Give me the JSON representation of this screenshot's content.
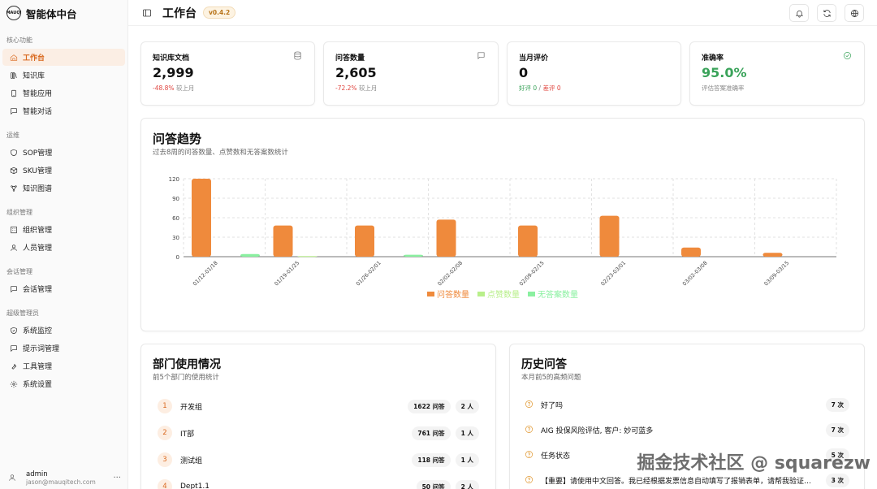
{
  "app": {
    "logo_text": "MAUQI",
    "name": "智能体中台"
  },
  "sidebar": {
    "sections": [
      {
        "title": "核心功能",
        "items": [
          {
            "label": "工作台",
            "icon": "home-icon",
            "active": true
          },
          {
            "label": "知识库",
            "icon": "library-icon"
          },
          {
            "label": "智能应用",
            "icon": "phone-icon"
          },
          {
            "label": "智能对话",
            "icon": "chat-icon"
          }
        ]
      },
      {
        "title": "运维",
        "items": [
          {
            "label": "SOP管理",
            "icon": "shield-icon"
          },
          {
            "label": "SKU管理",
            "icon": "box-icon"
          },
          {
            "label": "知识图谱",
            "icon": "graph-icon"
          }
        ]
      },
      {
        "title": "组织管理",
        "items": [
          {
            "label": "组织管理",
            "icon": "building-icon"
          },
          {
            "label": "人员管理",
            "icon": "user-icon"
          }
        ]
      },
      {
        "title": "会话管理",
        "items": [
          {
            "label": "会话管理",
            "icon": "chat-icon"
          }
        ]
      },
      {
        "title": "超级管理员",
        "items": [
          {
            "label": "系统监控",
            "icon": "monitor-icon"
          },
          {
            "label": "提示词管理",
            "icon": "chat-icon"
          },
          {
            "label": "工具管理",
            "icon": "wrench-icon"
          },
          {
            "label": "系统设置",
            "icon": "gear-icon"
          }
        ]
      }
    ],
    "user": {
      "name": "admin",
      "email": "jason@mauqitech.com",
      "more": "···"
    }
  },
  "header": {
    "title": "工作台",
    "version": "v0.4.2"
  },
  "stats": [
    {
      "title": "知识库文档",
      "value": "2,999",
      "delta": "-48.8%",
      "suffix": "较上月",
      "icon": "database-icon"
    },
    {
      "title": "问答数量",
      "value": "2,605",
      "delta": "-72.2%",
      "suffix": "较上月",
      "icon": "message-icon"
    },
    {
      "title": "当月评价",
      "value": "0",
      "good": "好评 0",
      "sep": "/",
      "bad": "差评 0"
    },
    {
      "title": "准确率",
      "value": "95.0%",
      "sub": "评估答案准确率",
      "icon": "check-circle-icon"
    }
  ],
  "chart": {
    "title": "问答趋势",
    "subtitle": "过去8周的问答数量、点赞数和无答案数统计"
  },
  "chart_data": {
    "type": "bar",
    "categories": [
      "01/12-01/18",
      "01/19-01/25",
      "01/26-02/01",
      "02/02-02/08",
      "02/09-02/15",
      "02/23-03/01",
      "03/02-03/08",
      "03/09-03/15"
    ],
    "series": [
      {
        "name": "问答数量",
        "color": "#ef8a3c",
        "values": [
          120,
          48,
          48,
          57,
          48,
          63,
          14,
          6
        ]
      },
      {
        "name": "点赞数量",
        "color": "#b8ef8a",
        "values": [
          0,
          1,
          0,
          0,
          0,
          0,
          0,
          0
        ]
      },
      {
        "name": "无答案数量",
        "color": "#8af0a0",
        "values": [
          4,
          0,
          3,
          0,
          0,
          0,
          0,
          0
        ]
      }
    ],
    "yticks": [
      0,
      30,
      60,
      90,
      120
    ],
    "ylim": [
      0,
      120
    ],
    "grid": true,
    "legend": "bottom-center"
  },
  "departments": {
    "title": "部门使用情况",
    "subtitle": "前5个部门的使用统计",
    "rows": [
      {
        "rank": "1",
        "name": "开发组",
        "qa": "1622 问答",
        "people": "2 人"
      },
      {
        "rank": "2",
        "name": "IT部",
        "qa": "761 问答",
        "people": "1 人"
      },
      {
        "rank": "3",
        "name": "测试组",
        "qa": "118 问答",
        "people": "1 人"
      },
      {
        "rank": "4",
        "name": "Dept1.1",
        "qa": "50 问答",
        "people": "2 人"
      }
    ]
  },
  "history": {
    "title": "历史问答",
    "subtitle": "本月前5的高频问题",
    "rows": [
      {
        "text": "好了吗",
        "count": "7 次"
      },
      {
        "text": "AIG 投保风险评估, 客户: 妙可蓝多",
        "count": "7 次"
      },
      {
        "text": "任务状态",
        "count": "5 次"
      },
      {
        "text": "【重要】请使用中文回答。我已经根据发票信息自动填写了报销表单，请帮我验证填写...",
        "count": "3 次"
      }
    ]
  },
  "watermark": "掘金技术社区 @ squarezw"
}
